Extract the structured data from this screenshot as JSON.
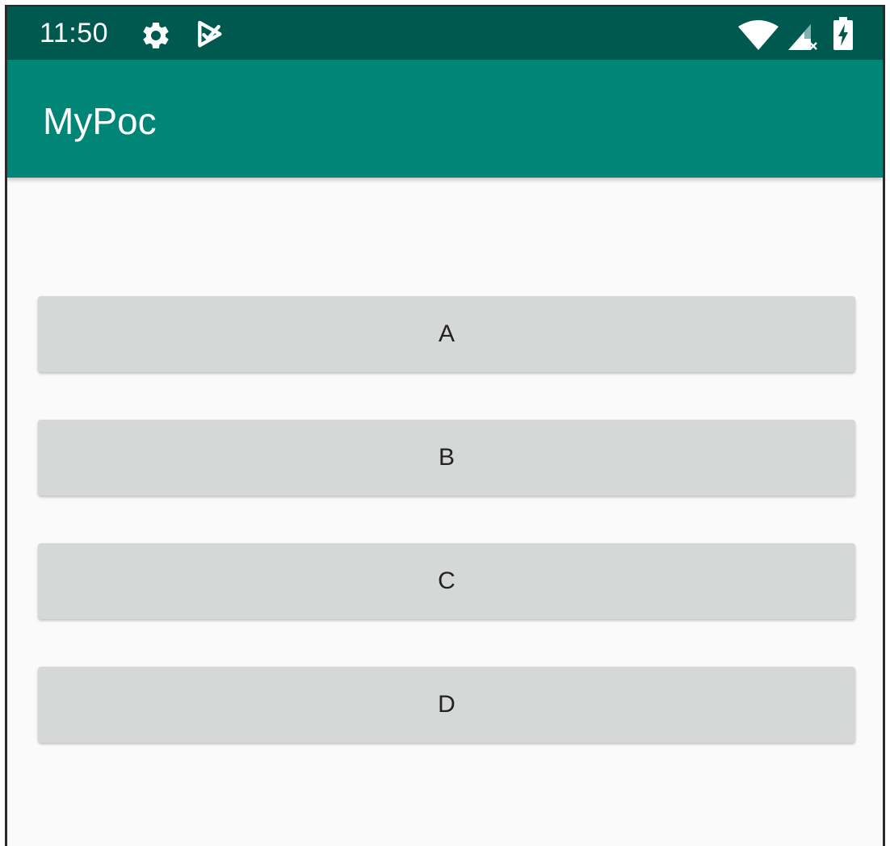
{
  "status_bar": {
    "time": "11:50",
    "icons": [
      "gear-icon",
      "play-protect-icon",
      "wifi-icon",
      "signal-icon",
      "battery-charging-icon"
    ]
  },
  "app_bar": {
    "title": "MyPoc"
  },
  "buttons": [
    {
      "label": "A"
    },
    {
      "label": "B"
    },
    {
      "label": "C"
    },
    {
      "label": "D"
    }
  ],
  "colors": {
    "status_bar": "#00594f",
    "app_bar": "#008577",
    "background": "#fafafa",
    "button": "#d6d7d7",
    "button_text": "#222222"
  }
}
